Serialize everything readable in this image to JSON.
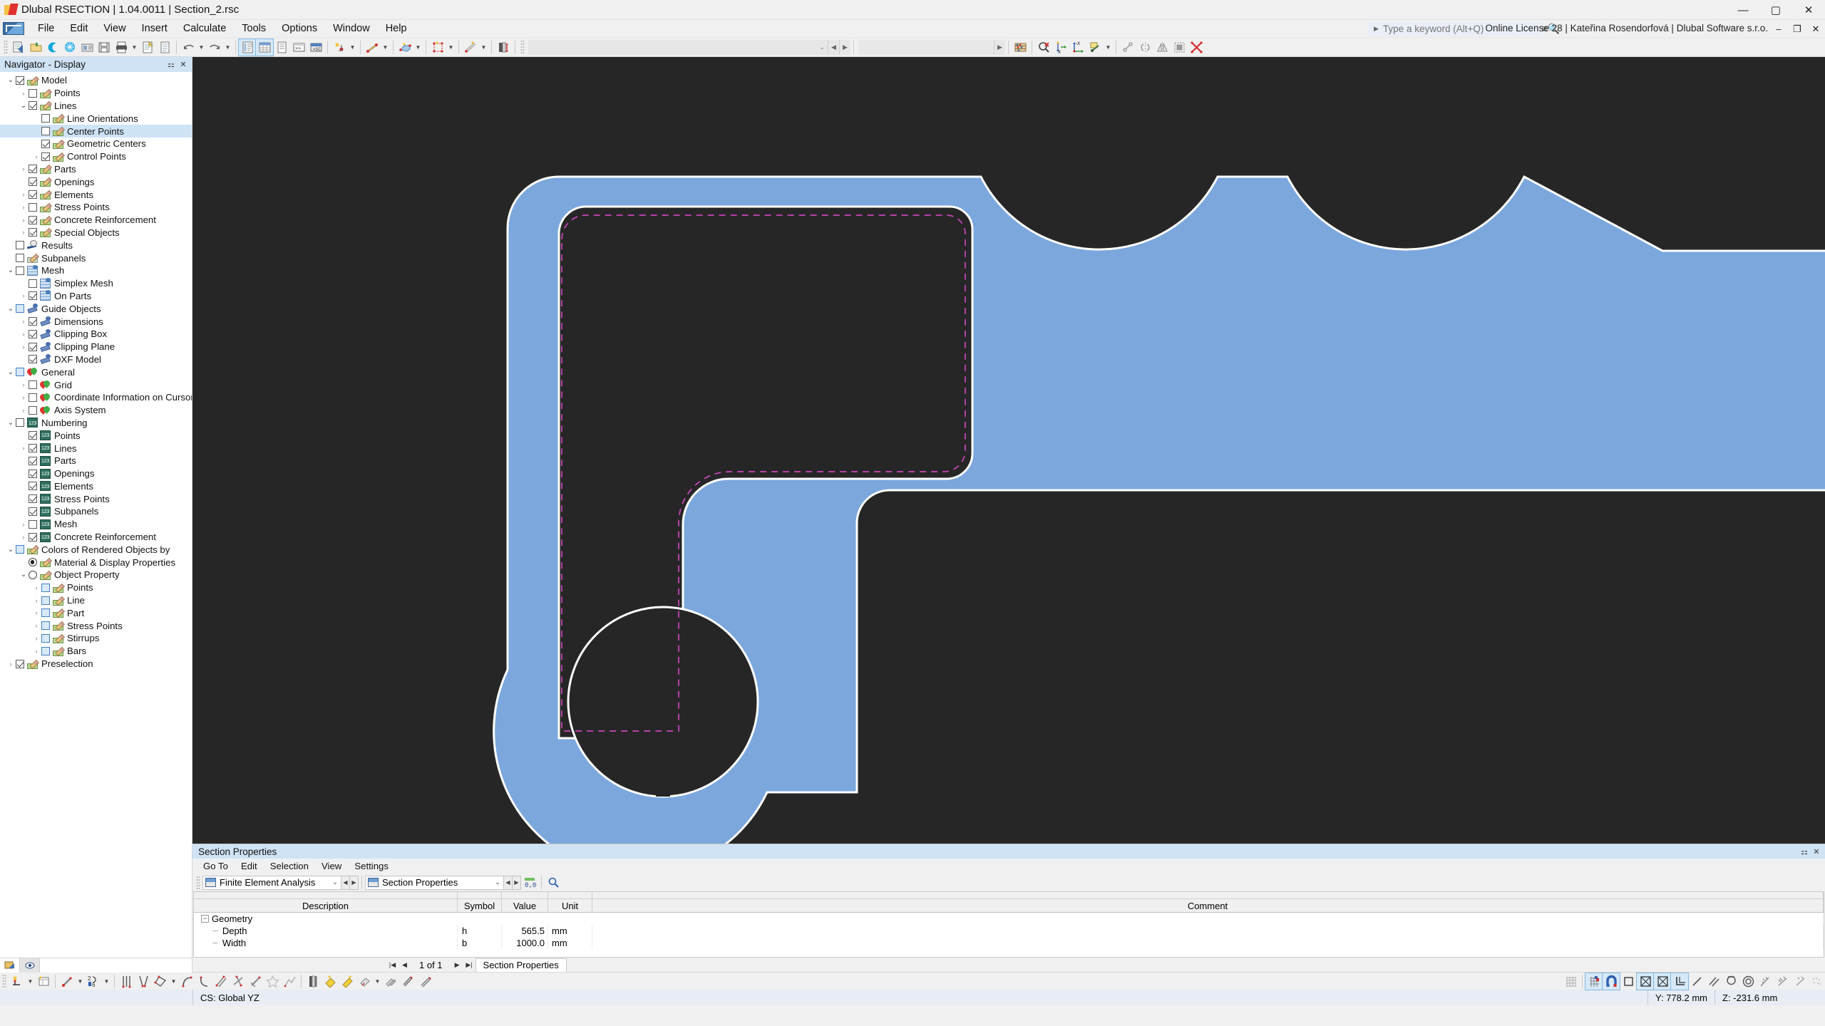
{
  "window": {
    "title": "Dlubal RSECTION | 1.04.0011 | Section_2.rsc",
    "minimize": "—",
    "maximize": "▢",
    "close": "✕"
  },
  "menubar": {
    "items": [
      "File",
      "Edit",
      "View",
      "Insert",
      "Calculate",
      "Tools",
      "Options",
      "Window",
      "Help"
    ],
    "search_placeholder": "Type a keyword (Alt+Q)",
    "license": "Online License 28 | Kateřina Rosendorfová | Dlubal Software s.r.o.",
    "min": "–",
    "restore": "❐",
    "close": "✕"
  },
  "toolbar": {
    "combo_value": "",
    "combo2_value": ""
  },
  "navigator": {
    "title": "Navigator - Display",
    "pin": "⚏",
    "close": "✕",
    "tree": [
      {
        "label": "Model",
        "indent": 0,
        "exp": "open",
        "check": "on",
        "icon": "pen",
        "sel": false
      },
      {
        "label": "Points",
        "indent": 1,
        "exp": "closed",
        "check": "off",
        "icon": "pen",
        "sel": false
      },
      {
        "label": "Lines",
        "indent": 1,
        "exp": "open",
        "check": "on",
        "icon": "pen",
        "sel": false
      },
      {
        "label": "Line Orientations",
        "indent": 2,
        "exp": "none",
        "check": "off",
        "icon": "pen",
        "sel": false
      },
      {
        "label": "Center Points",
        "indent": 2,
        "exp": "none",
        "check": "off",
        "icon": "pen",
        "sel": true
      },
      {
        "label": "Geometric Centers",
        "indent": 2,
        "exp": "none",
        "check": "on",
        "icon": "pen",
        "sel": false
      },
      {
        "label": "Control Points",
        "indent": 2,
        "exp": "closed",
        "check": "on",
        "icon": "pen",
        "sel": false
      },
      {
        "label": "Parts",
        "indent": 1,
        "exp": "closed",
        "check": "on",
        "icon": "pen",
        "sel": false
      },
      {
        "label": "Openings",
        "indent": 1,
        "exp": "none",
        "check": "on",
        "icon": "pen",
        "sel": false
      },
      {
        "label": "Elements",
        "indent": 1,
        "exp": "closed",
        "check": "on",
        "icon": "pen",
        "sel": false
      },
      {
        "label": "Stress Points",
        "indent": 1,
        "exp": "closed",
        "check": "off",
        "icon": "pen",
        "sel": false
      },
      {
        "label": "Concrete Reinforcement",
        "indent": 1,
        "exp": "closed",
        "check": "on",
        "icon": "pen",
        "sel": false
      },
      {
        "label": "Special Objects",
        "indent": 1,
        "exp": "closed",
        "check": "on",
        "icon": "pen",
        "sel": false
      },
      {
        "label": "Results",
        "indent": 0,
        "exp": "none",
        "check": "off",
        "icon": "res",
        "sel": false
      },
      {
        "label": "Subpanels",
        "indent": 0,
        "exp": "none",
        "check": "off",
        "icon": "pengrey",
        "sel": false
      },
      {
        "label": "Mesh",
        "indent": 0,
        "exp": "open",
        "check": "off",
        "icon": "mesh",
        "sel": false
      },
      {
        "label": "Simplex Mesh",
        "indent": 1,
        "exp": "none",
        "check": "off",
        "icon": "mesh",
        "sel": false
      },
      {
        "label": "On Parts",
        "indent": 1,
        "exp": "closed",
        "check": "on",
        "icon": "mesh",
        "sel": false
      },
      {
        "label": "Guide Objects",
        "indent": 0,
        "exp": "open",
        "check": "tri",
        "icon": "guide",
        "sel": false
      },
      {
        "label": "Dimensions",
        "indent": 1,
        "exp": "closed",
        "check": "on",
        "icon": "guide",
        "sel": false
      },
      {
        "label": "Clipping Box",
        "indent": 1,
        "exp": "closed",
        "check": "on",
        "icon": "guide",
        "sel": false
      },
      {
        "label": "Clipping Plane",
        "indent": 1,
        "exp": "closed",
        "check": "on",
        "icon": "guide",
        "sel": false
      },
      {
        "label": "DXF Model",
        "indent": 1,
        "exp": "none",
        "check": "on",
        "icon": "guide",
        "sel": false
      },
      {
        "label": "General",
        "indent": 0,
        "exp": "open",
        "check": "tri",
        "icon": "heart",
        "sel": false
      },
      {
        "label": "Grid",
        "indent": 1,
        "exp": "closed",
        "check": "off",
        "icon": "heart",
        "sel": false
      },
      {
        "label": "Coordinate Information on Cursor",
        "indent": 1,
        "exp": "closed",
        "check": "off",
        "icon": "heart",
        "sel": false
      },
      {
        "label": "Axis System",
        "indent": 1,
        "exp": "closed",
        "check": "off",
        "icon": "heart",
        "sel": false
      },
      {
        "label": "Numbering",
        "indent": 0,
        "exp": "open",
        "check": "off",
        "icon": "num",
        "sel": false
      },
      {
        "label": "Points",
        "indent": 1,
        "exp": "none",
        "check": "on",
        "icon": "num",
        "sel": false
      },
      {
        "label": "Lines",
        "indent": 1,
        "exp": "closed",
        "check": "on",
        "icon": "num",
        "sel": false
      },
      {
        "label": "Parts",
        "indent": 1,
        "exp": "none",
        "check": "on",
        "icon": "num",
        "sel": false
      },
      {
        "label": "Openings",
        "indent": 1,
        "exp": "none",
        "check": "on",
        "icon": "num",
        "sel": false
      },
      {
        "label": "Elements",
        "indent": 1,
        "exp": "none",
        "check": "on",
        "icon": "num",
        "sel": false
      },
      {
        "label": "Stress Points",
        "indent": 1,
        "exp": "none",
        "check": "on",
        "icon": "num",
        "sel": false
      },
      {
        "label": "Subpanels",
        "indent": 1,
        "exp": "none",
        "check": "on",
        "icon": "num",
        "sel": false
      },
      {
        "label": "Mesh",
        "indent": 1,
        "exp": "closed",
        "check": "off",
        "icon": "num",
        "sel": false
      },
      {
        "label": "Concrete Reinforcement",
        "indent": 1,
        "exp": "closed",
        "check": "on",
        "icon": "num",
        "sel": false
      },
      {
        "label": "Colors of Rendered Objects by",
        "indent": 0,
        "exp": "open",
        "check": "tri",
        "icon": "pen",
        "sel": false
      },
      {
        "label": "Material & Display Properties",
        "indent": 1,
        "exp": "none",
        "check": "radio-on",
        "icon": "pen",
        "sel": false
      },
      {
        "label": "Object Property",
        "indent": 1,
        "exp": "open",
        "check": "radio-off",
        "icon": "pen",
        "sel": false
      },
      {
        "label": "Points",
        "indent": 2,
        "exp": "closed",
        "check": "tri",
        "icon": "pen",
        "sel": false
      },
      {
        "label": "Line",
        "indent": 2,
        "exp": "closed",
        "check": "tri",
        "icon": "pen",
        "sel": false
      },
      {
        "label": "Part",
        "indent": 2,
        "exp": "closed",
        "check": "tri",
        "icon": "pen",
        "sel": false
      },
      {
        "label": "Stress Points",
        "indent": 2,
        "exp": "closed",
        "check": "tri",
        "icon": "pen",
        "sel": false
      },
      {
        "label": "Stirrups",
        "indent": 2,
        "exp": "closed",
        "check": "tri",
        "icon": "pen",
        "sel": false
      },
      {
        "label": "Bars",
        "indent": 2,
        "exp": "closed",
        "check": "tri",
        "icon": "pen",
        "sel": false
      },
      {
        "label": "Preselection",
        "indent": 0,
        "exp": "closed",
        "check": "on",
        "icon": "pen",
        "sel": false
      }
    ]
  },
  "section_properties": {
    "title": "Section Properties",
    "pin": "⚏",
    "close": "✕",
    "menu": [
      "Go To",
      "Edit",
      "Selection",
      "View",
      "Settings"
    ],
    "combo1": "Finite Element Analysis",
    "combo2": "Section Properties",
    "columns": [
      "Description",
      "Symbol",
      "Value",
      "Unit",
      "Comment"
    ],
    "group": "Geometry",
    "rows": [
      {
        "description": "Depth",
        "symbol": "h",
        "value": "565.5",
        "unit": "mm",
        "comment": ""
      },
      {
        "description": "Width",
        "symbol": "b",
        "value": "1000.0",
        "unit": "mm",
        "comment": ""
      }
    ],
    "page_indicator": "1 of 1",
    "tab": "Section Properties",
    "first": "|◀",
    "prev": "◀",
    "next": "▶",
    "last": "▶|"
  },
  "status": {
    "cs": "CS: Global YZ",
    "y": "Y: 778.2 mm",
    "z": "Z: -231.6 mm"
  },
  "viewport": {
    "section_fill": "#7ba7dd",
    "section_stroke": "#ffffff",
    "background": "#262626",
    "dashed_color": "#cc44bb"
  }
}
